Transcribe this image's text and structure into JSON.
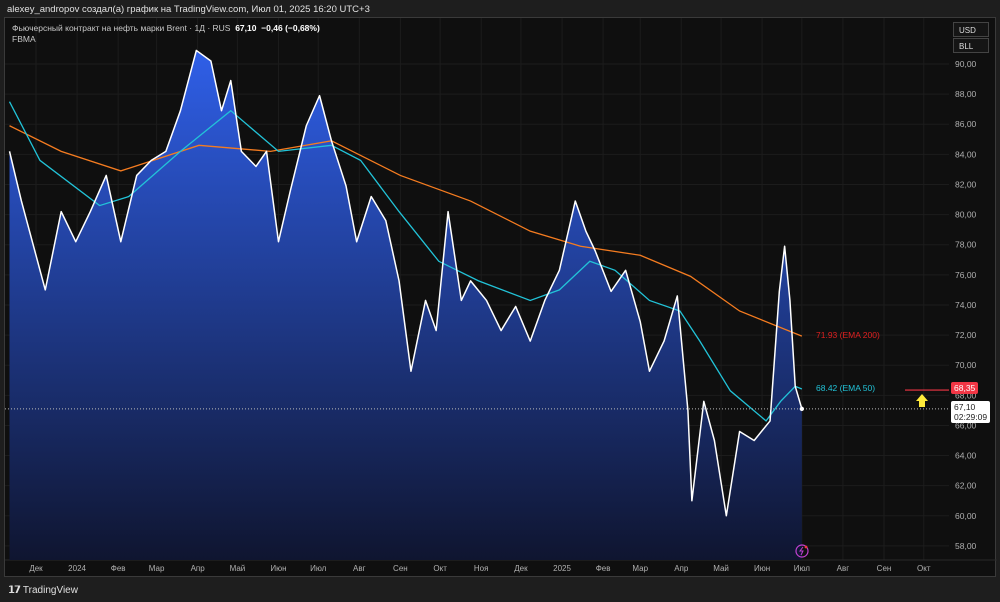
{
  "header": {
    "attribution": "alexey_andropov создал(а) график на TradingView.com, Июл 01, 2025 16:20 UTC+3"
  },
  "legend": {
    "symbol": "Фьючерсный контракт на нефть марки Brent · 1Д · RUS",
    "last": "67,10",
    "change": "−0,46 (−0,68%)",
    "indicator": "FBMA"
  },
  "currency": {
    "usd": "USD",
    "unit": "BLL"
  },
  "labels": {
    "ema200": "71.93 (EMA 200)",
    "ema50": "68.42 (EMA 50)",
    "alert": "68,35",
    "price": "67,10",
    "countdown": "02:29:09"
  },
  "footer": {
    "brand": "TradingView",
    "logo": "TV"
  },
  "colors": {
    "price": "#ffffff",
    "ema50": "#22c3d8",
    "ema200": "#f57c20",
    "alert": "#f23645",
    "fill_top": "#2f5fe8",
    "fill_bottom": "#0f1530",
    "arrow": "#ffeb3b"
  },
  "chart_data": {
    "type": "area",
    "ylim": [
      57,
      92
    ],
    "yticks": [
      "58,00",
      "60,00",
      "62,00",
      "64,00",
      "66,00",
      "68,00",
      "70,00",
      "72,00",
      "74,00",
      "76,00",
      "78,00",
      "80,00",
      "82,00",
      "84,00",
      "86,00",
      "88,00",
      "90,00"
    ],
    "xlim": [
      "2023-11-06",
      "2025-10-20"
    ],
    "xticks": [
      {
        "d": "2023-12-01",
        "l": "Дек"
      },
      {
        "d": "2024-01-01",
        "l": "2024"
      },
      {
        "d": "2024-02-01",
        "l": "Фев"
      },
      {
        "d": "2024-03-01",
        "l": "Мар"
      },
      {
        "d": "2024-04-01",
        "l": "Апр"
      },
      {
        "d": "2024-05-01",
        "l": "Май"
      },
      {
        "d": "2024-06-01",
        "l": "Июн"
      },
      {
        "d": "2024-07-01",
        "l": "Июл"
      },
      {
        "d": "2024-08-01",
        "l": "Авг"
      },
      {
        "d": "2024-09-01",
        "l": "Сен"
      },
      {
        "d": "2024-10-01",
        "l": "Окт"
      },
      {
        "d": "2024-11-01",
        "l": "Ноя"
      },
      {
        "d": "2024-12-01",
        "l": "Дек"
      },
      {
        "d": "2025-01-01",
        "l": "2025"
      },
      {
        "d": "2025-02-01",
        "l": "Фев"
      },
      {
        "d": "2025-03-01",
        "l": "Мар"
      },
      {
        "d": "2025-04-01",
        "l": "Апр"
      },
      {
        "d": "2025-05-01",
        "l": "Май"
      },
      {
        "d": "2025-06-01",
        "l": "Июн"
      },
      {
        "d": "2025-07-01",
        "l": "Июл"
      },
      {
        "d": "2025-08-01",
        "l": "Авг"
      },
      {
        "d": "2025-09-01",
        "l": "Сен"
      },
      {
        "d": "2025-10-01",
        "l": "Окт"
      }
    ],
    "series": [
      {
        "name": "Brent",
        "points": [
          [
            "2023-11-11",
            84.2
          ],
          [
            "2023-11-20",
            80.9
          ],
          [
            "2023-12-08",
            75
          ],
          [
            "2023-12-20",
            80.2
          ],
          [
            "2023-12-31",
            78.2
          ],
          [
            "2024-01-11",
            80.2
          ],
          [
            "2024-01-23",
            82.6
          ],
          [
            "2024-02-03",
            78.2
          ],
          [
            "2024-02-15",
            82.6
          ],
          [
            "2024-02-26",
            83.6
          ],
          [
            "2024-03-08",
            84.2
          ],
          [
            "2024-03-19",
            86.9
          ],
          [
            "2024-03-31",
            90.9
          ],
          [
            "2024-04-11",
            90.2
          ],
          [
            "2024-04-19",
            86.9
          ],
          [
            "2024-04-26",
            88.9
          ],
          [
            "2024-05-04",
            84.2
          ],
          [
            "2024-05-15",
            83.2
          ],
          [
            "2024-05-23",
            84.2
          ],
          [
            "2024-06-01",
            78.2
          ],
          [
            "2024-06-10",
            81.6
          ],
          [
            "2024-06-22",
            85.9
          ],
          [
            "2024-07-02",
            87.9
          ],
          [
            "2024-07-11",
            84.9
          ],
          [
            "2024-07-22",
            81.9
          ],
          [
            "2024-07-30",
            78.2
          ],
          [
            "2024-08-10",
            81.2
          ],
          [
            "2024-08-21",
            79.6
          ],
          [
            "2024-08-31",
            75.6
          ],
          [
            "2024-09-09",
            69.6
          ],
          [
            "2024-09-20",
            74.3
          ],
          [
            "2024-09-28",
            72.3
          ],
          [
            "2024-10-07",
            80.2
          ],
          [
            "2024-10-17",
            74.3
          ],
          [
            "2024-10-24",
            75.6
          ],
          [
            "2024-11-05",
            74.3
          ],
          [
            "2024-11-16",
            72.3
          ],
          [
            "2024-11-27",
            73.9
          ],
          [
            "2024-12-08",
            71.6
          ],
          [
            "2024-12-19",
            74.3
          ],
          [
            "2024-12-30",
            76.3
          ],
          [
            "2025-01-11",
            80.9
          ],
          [
            "2025-01-19",
            78.9
          ],
          [
            "2025-01-26",
            77.6
          ],
          [
            "2025-02-07",
            74.9
          ],
          [
            "2025-02-18",
            76.3
          ],
          [
            "2025-03-01",
            72.9
          ],
          [
            "2025-03-08",
            69.6
          ],
          [
            "2025-03-19",
            71.6
          ],
          [
            "2025-03-29",
            74.6
          ],
          [
            "2025-04-06",
            67
          ],
          [
            "2025-04-09",
            61
          ],
          [
            "2025-04-18",
            67.6
          ],
          [
            "2025-04-26",
            65
          ],
          [
            "2025-05-05",
            60
          ],
          [
            "2025-05-15",
            65.6
          ],
          [
            "2025-05-26",
            65
          ],
          [
            "2025-06-07",
            66.3
          ],
          [
            "2025-06-14",
            74.9
          ],
          [
            "2025-06-18",
            77.9
          ],
          [
            "2025-06-22",
            74.3
          ],
          [
            "2025-06-26",
            68.6
          ],
          [
            "2025-07-01",
            67.1
          ]
        ]
      },
      {
        "name": "EMA 50",
        "points": [
          [
            "2023-11-11",
            87.5
          ],
          [
            "2023-12-04",
            83.6
          ],
          [
            "2024-01-18",
            80.6
          ],
          [
            "2024-02-09",
            81.2
          ],
          [
            "2024-03-19",
            84.2
          ],
          [
            "2024-04-26",
            86.9
          ],
          [
            "2024-06-01",
            84.2
          ],
          [
            "2024-07-11",
            84.6
          ],
          [
            "2024-08-02",
            83.6
          ],
          [
            "2024-08-31",
            80.2
          ],
          [
            "2024-09-30",
            76.9
          ],
          [
            "2024-10-30",
            75.6
          ],
          [
            "2024-12-08",
            74.3
          ],
          [
            "2024-12-30",
            75
          ],
          [
            "2025-01-22",
            76.9
          ],
          [
            "2025-02-10",
            76.3
          ],
          [
            "2025-03-08",
            74.3
          ],
          [
            "2025-03-31",
            73.6
          ],
          [
            "2025-04-15",
            71.6
          ],
          [
            "2025-05-08",
            68.3
          ],
          [
            "2025-06-04",
            66.3
          ],
          [
            "2025-06-15",
            67.6
          ],
          [
            "2025-06-26",
            68.6
          ],
          [
            "2025-07-01",
            68.42
          ]
        ]
      },
      {
        "name": "EMA 200",
        "points": [
          [
            "2023-11-11",
            85.9
          ],
          [
            "2023-12-20",
            84.2
          ],
          [
            "2024-02-03",
            82.9
          ],
          [
            "2024-04-02",
            84.6
          ],
          [
            "2024-05-26",
            84.2
          ],
          [
            "2024-07-11",
            84.9
          ],
          [
            "2024-09-01",
            82.6
          ],
          [
            "2024-10-24",
            80.9
          ],
          [
            "2024-12-08",
            78.9
          ],
          [
            "2025-01-15",
            77.9
          ],
          [
            "2025-03-01",
            77.3
          ],
          [
            "2025-04-08",
            75.9
          ],
          [
            "2025-05-15",
            73.6
          ],
          [
            "2025-07-01",
            71.93
          ]
        ]
      }
    ]
  }
}
